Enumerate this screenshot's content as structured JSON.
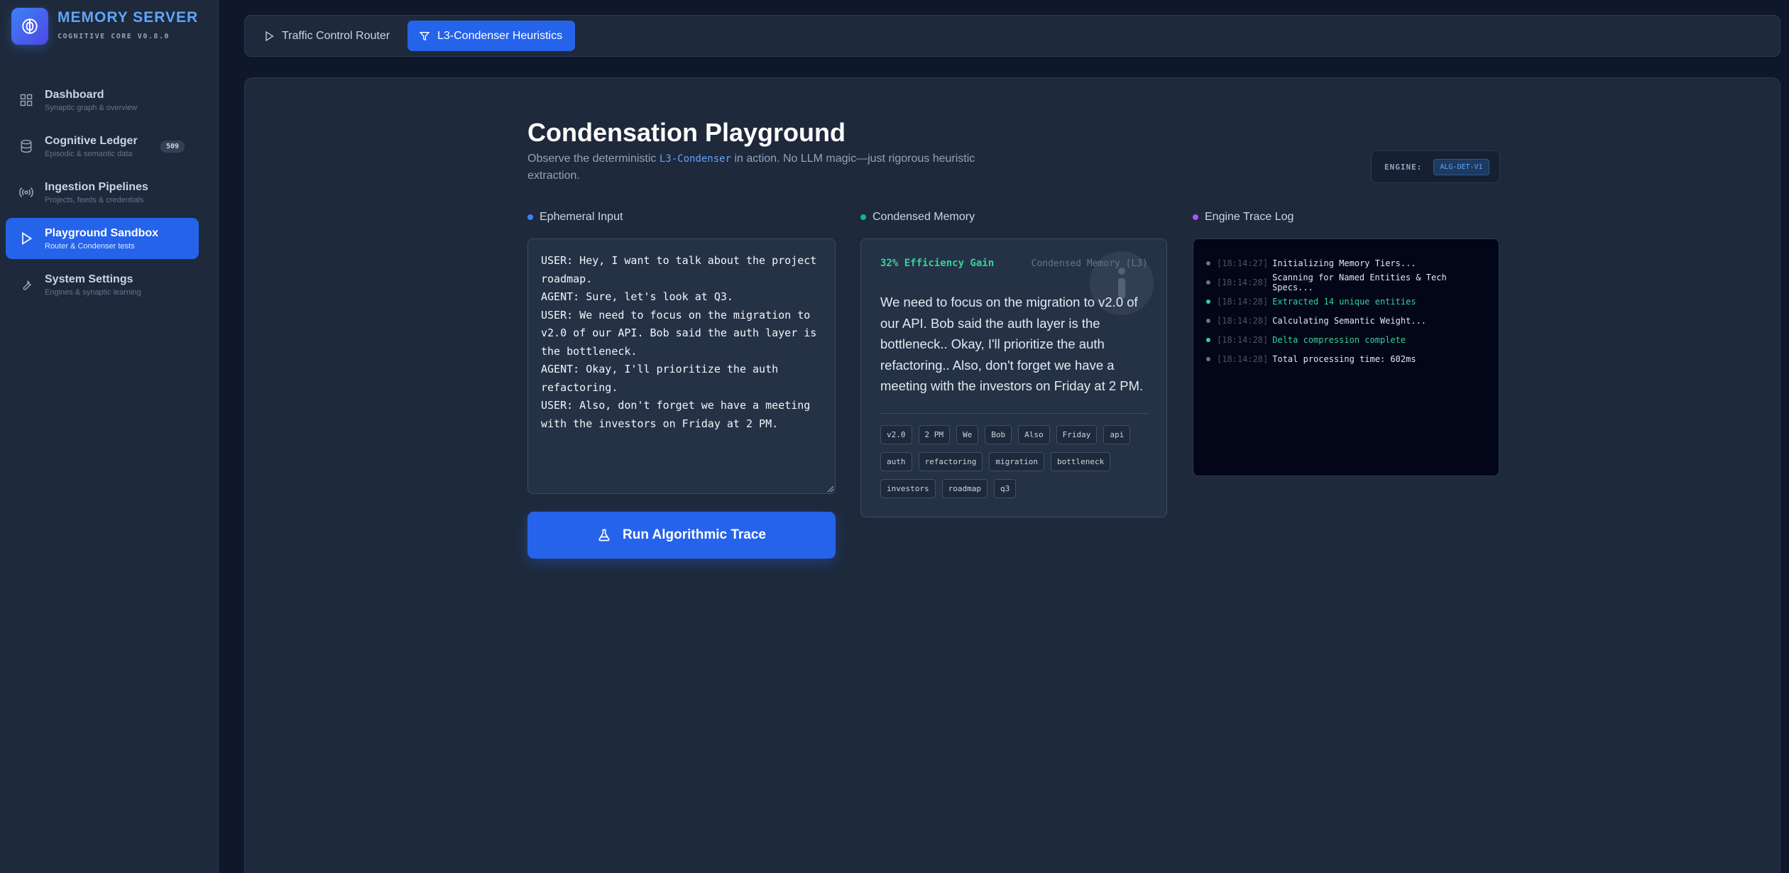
{
  "brand": {
    "title": "MEMORY SERVER",
    "subtitle": "COGNITIVE CORE V0.8.0"
  },
  "sidebar": {
    "items": [
      {
        "label": "Dashboard",
        "desc": "Synaptic graph & overview",
        "icon": "grid-icon"
      },
      {
        "label": "Cognitive Ledger",
        "desc": "Episodic & semantic data",
        "icon": "database-icon",
        "badge": "509"
      },
      {
        "label": "Ingestion Pipelines",
        "desc": "Projects, feeds & credentials",
        "icon": "broadcast-icon"
      },
      {
        "label": "Playground Sandbox",
        "desc": "Router & Condenser tests",
        "icon": "play-icon",
        "active": true
      },
      {
        "label": "System Settings",
        "desc": "Engines & synaptic learning",
        "icon": "wrench-icon"
      }
    ]
  },
  "tabs": [
    {
      "label": "Traffic Control Router",
      "icon": "play-icon"
    },
    {
      "label": "L3-Condenser Heuristics",
      "icon": "filter-icon",
      "active": true
    }
  ],
  "main": {
    "title": "Condensation Playground",
    "subtitle_pre": "Observe the deterministic ",
    "subtitle_code": "L3-Condenser",
    "subtitle_post": " in action. No LLM magic—just rigorous heuristic extraction.",
    "engine_label": "ENGINE:",
    "engine_value": "ALG-DET-V1"
  },
  "input": {
    "heading": "Ephemeral Input",
    "value": "USER: Hey, I want to talk about the project roadmap.\nAGENT: Sure, let's look at Q3.\nUSER: We need to focus on the migration to v2.0 of our API. Bob said the auth layer is the bottleneck.\nAGENT: Okay, I'll prioritize the auth refactoring.\nUSER: Also, don't forget we have a meeting with the investors on Friday at 2 PM.",
    "run_label": "Run Algorithmic Trace"
  },
  "condensed": {
    "heading": "Condensed Memory",
    "efficiency": "32% Efficiency Gain",
    "label": "Condensed Memory (L3)",
    "text": "We need to focus on the migration to v2.0 of our API. Bob said the auth layer is the bottleneck.. Okay, I'll prioritize the auth refactoring.. Also, don't forget we have a meeting with the investors on Friday at 2 PM.",
    "tags": [
      "v2.0",
      "2 PM",
      "We",
      "Bob",
      "Also",
      "Friday",
      "api",
      "auth",
      "refactoring",
      "migration",
      "bottleneck",
      "investors",
      "roadmap",
      "q3"
    ]
  },
  "trace": {
    "heading": "Engine Trace Log",
    "lines": [
      {
        "time": "[18:14:27]",
        "msg": "Initializing Memory Tiers...",
        "ok": false
      },
      {
        "time": "[18:14:28]",
        "msg": "Scanning for Named Entities & Tech Specs...",
        "ok": false
      },
      {
        "time": "[18:14:28]",
        "msg": "Extracted 14 unique entities",
        "ok": true
      },
      {
        "time": "[18:14:28]",
        "msg": "Calculating Semantic Weight...",
        "ok": false
      },
      {
        "time": "[18:14:28]",
        "msg": "Delta compression complete",
        "ok": true
      },
      {
        "time": "[18:14:28]",
        "msg": "Total processing time: 602ms",
        "ok": false
      }
    ]
  },
  "colors": {
    "accent": "#2563eb",
    "success": "#34d399",
    "input_dot": "#3b82f6",
    "condensed_dot": "#10b981",
    "trace_dot": "#a855f7"
  }
}
